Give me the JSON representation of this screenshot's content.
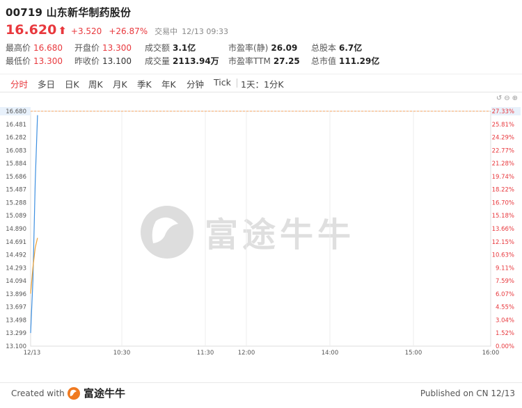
{
  "stock": {
    "title": "00719 山东新华制药股份",
    "price": "16.620",
    "change": "+3.520",
    "change_pct": "+26.87%",
    "status": "交易中",
    "time": "12/13 09:33"
  },
  "stats": {
    "high_label": "最高价",
    "high": "16.680",
    "low_label": "最低价",
    "low": "13.300",
    "open_label": "开盘价",
    "open": "13.300",
    "prev_label": "昨收价",
    "prev": "13.100",
    "turnover_label": "成交额",
    "turnover": "3.1亿",
    "volume_label": "成交量",
    "volume": "2113.94万",
    "pe_static_label": "市盈率(静)",
    "pe_static": "26.09",
    "pe_ttm_label": "市盈率TTM",
    "pe_ttm": "27.25",
    "shares_label": "总股本",
    "shares": "6.7亿",
    "mktcap_label": "总市值",
    "mktcap": "111.29亿"
  },
  "tabs": [
    "分时",
    "多日",
    "日K",
    "周K",
    "月K",
    "季K",
    "年K",
    "分钟",
    "Tick",
    "1天：1分K"
  ],
  "controls": [
    "undo-icon",
    "zoom-out-icon",
    "zoom-in-icon"
  ],
  "colors": {
    "up": "#e8383d",
    "price_line": "#3d8fe0",
    "avg_line": "#f0a030",
    "ref_line": "#f5a25d"
  },
  "chart_data": {
    "type": "line",
    "y_left_ticks": [
      "16.680",
      "16.481",
      "16.282",
      "16.083",
      "15.884",
      "15.686",
      "15.487",
      "15.288",
      "15.089",
      "14.890",
      "14.691",
      "14.492",
      "14.293",
      "14.094",
      "13.896",
      "13.697",
      "13.498",
      "13.299",
      "13.100"
    ],
    "y_right_ticks": [
      "27.33%",
      "25.81%",
      "24.29%",
      "22.77%",
      "21.28%",
      "19.74%",
      "18.22%",
      "16.70%",
      "15.18%",
      "13.66%",
      "12.15%",
      "10.63%",
      "9.11%",
      "7.59%",
      "6.07%",
      "4.55%",
      "3.04%",
      "1.52%",
      "0.00%"
    ],
    "x_ticks": [
      "12/13",
      "10:30",
      "11:30",
      "12:00",
      "14:00",
      "15:00",
      "16:00"
    ],
    "ylim": [
      13.1,
      16.68
    ],
    "series": [
      {
        "x": [
          "09:30",
          "09:31",
          "09:32",
          "09:33"
        ],
        "values": [
          13.3,
          14.1,
          15.6,
          16.62
        ]
      },
      {
        "x": [
          "09:30",
          "09:31",
          "09:32",
          "09:33"
        ],
        "values": [
          13.9,
          14.3,
          14.6,
          14.75
        ]
      }
    ]
  },
  "footer": {
    "created": "Created with",
    "brand": "富途牛牛",
    "published": "Published on CN 12/13"
  },
  "watermark": "富途牛牛"
}
